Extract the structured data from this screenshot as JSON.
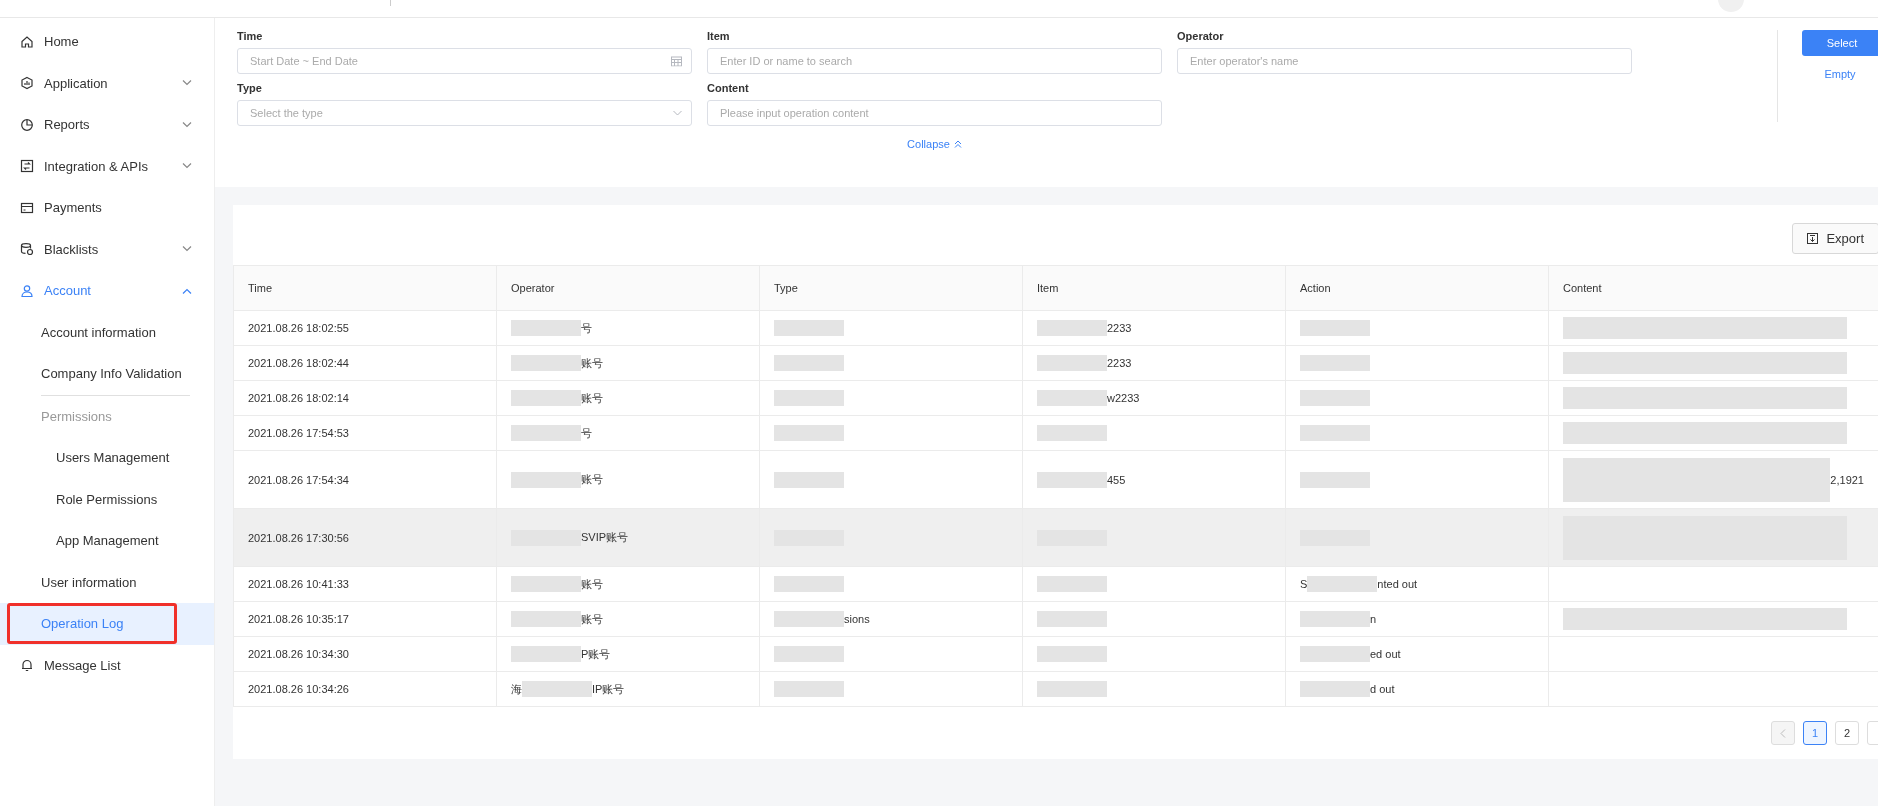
{
  "sidebar": {
    "items": [
      {
        "label": "Home",
        "kind": "link",
        "selected": false
      },
      {
        "label": "Application",
        "kind": "group",
        "expanded": false,
        "selected": false
      },
      {
        "label": "Reports",
        "kind": "group",
        "expanded": false,
        "selected": false
      },
      {
        "label": "Integration & APIs",
        "kind": "group",
        "expanded": false,
        "selected": false
      },
      {
        "label": "Payments",
        "kind": "link",
        "selected": false
      },
      {
        "label": "Blacklists",
        "kind": "group",
        "expanded": false,
        "selected": false
      },
      {
        "label": "Account",
        "kind": "group",
        "expanded": true,
        "selected": true,
        "children": [
          {
            "label": "Account information",
            "kind": "link",
            "selected": false
          },
          {
            "label": "Company Info Validation",
            "kind": "link",
            "selected": false
          },
          {
            "label": "Permissions",
            "kind": "section",
            "children": [
              {
                "label": "Users Management",
                "selected": false
              },
              {
                "label": "Role Permissions",
                "selected": false
              },
              {
                "label": "App Management",
                "selected": false
              }
            ]
          },
          {
            "label": "User information",
            "kind": "link",
            "selected": false
          },
          {
            "label": "Operation Log",
            "kind": "link",
            "selected": true,
            "outlined": true
          }
        ]
      },
      {
        "label": "Message List",
        "kind": "link",
        "selected": false
      }
    ]
  },
  "filters": {
    "fields": [
      {
        "label": "Time",
        "placeholder": "Start Date ~ End Date",
        "kind": "date"
      },
      {
        "label": "Item",
        "placeholder": "Enter ID or name to search",
        "kind": "text"
      },
      {
        "label": "Operator",
        "placeholder": "Enter operator's name",
        "kind": "text"
      },
      {
        "label": "Type",
        "placeholder": "Select the type",
        "kind": "select"
      },
      {
        "label": "Content",
        "placeholder": "Please input operation content",
        "kind": "text"
      }
    ],
    "collapse": "Collapse",
    "select_button": "Select",
    "empty_link": "Empty"
  },
  "export_button": "Export",
  "table": {
    "columns": [
      "Time",
      "Operator",
      "Type",
      "Item",
      "Action",
      "Content"
    ],
    "rows": [
      {
        "kind": "single",
        "selected": false,
        "cells": [
          {
            "text": "2021.08.26 18:02:55"
          },
          {
            "redacted": true,
            "text": "号"
          },
          {
            "redacted": true
          },
          {
            "redacted": true,
            "text": "2233"
          },
          {
            "redacted": true
          },
          {
            "redacted": true
          }
        ]
      },
      {
        "kind": "single",
        "selected": false,
        "cells": [
          {
            "text": "2021.08.26 18:02:44"
          },
          {
            "redacted": true,
            "text": "账号"
          },
          {
            "redacted": true
          },
          {
            "redacted": true,
            "text": "2233"
          },
          {
            "redacted": true
          },
          {
            "redacted": true
          }
        ]
      },
      {
        "kind": "single",
        "selected": false,
        "cells": [
          {
            "text": "2021.08.26 18:02:14"
          },
          {
            "redacted": true,
            "text": "账号"
          },
          {
            "redacted": true
          },
          {
            "redacted": true,
            "text": "w2233"
          },
          {
            "redacted": true
          },
          {
            "redacted": true
          }
        ]
      },
      {
        "kind": "single",
        "selected": false,
        "cells": [
          {
            "text": "2021.08.26 17:54:53"
          },
          {
            "redacted": true,
            "text": "号"
          },
          {
            "redacted": true
          },
          {
            "redacted": true
          },
          {
            "redacted": true
          },
          {
            "redacted": true
          }
        ]
      },
      {
        "kind": "double",
        "selected": false,
        "cells": [
          {
            "text": "2021.08.26 17:54:34"
          },
          {
            "redacted": true,
            "text": "账号"
          },
          {
            "redacted": true
          },
          {
            "redacted": true,
            "text": "455"
          },
          {
            "redacted": true
          },
          {
            "redacted": true,
            "text": "2,1921"
          }
        ]
      },
      {
        "kind": "double",
        "selected": true,
        "cells": [
          {
            "text": "2021.08.26 17:30:56"
          },
          {
            "redacted": true,
            "text": "SVIP账号"
          },
          {
            "redacted": true
          },
          {
            "redacted": true
          },
          {
            "redacted": true
          },
          {
            "redacted": true
          }
        ]
      },
      {
        "kind": "single",
        "selected": false,
        "cells": [
          {
            "text": "2021.08.26 10:41:33"
          },
          {
            "redacted": true,
            "text": "账号"
          },
          {
            "redacted": true
          },
          {
            "redacted": true
          },
          {
            "lead": "S",
            "redacted": true,
            "text": "nted out"
          },
          {}
        ]
      },
      {
        "kind": "single",
        "selected": false,
        "cells": [
          {
            "text": "2021.08.26 10:35:17"
          },
          {
            "redacted": true,
            "text": "账号"
          },
          {
            "redacted": true,
            "text": "sions"
          },
          {
            "redacted": true
          },
          {
            "redacted": true,
            "text": "n"
          },
          {
            "redacted": true
          }
        ]
      },
      {
        "kind": "single",
        "selected": false,
        "cells": [
          {
            "text": "2021.08.26 10:34:30"
          },
          {
            "redacted": true,
            "text": "P账号"
          },
          {
            "redacted": true
          },
          {
            "redacted": true
          },
          {
            "redacted": true,
            "text": "ed out"
          },
          {}
        ]
      },
      {
        "kind": "single",
        "selected": false,
        "cells": [
          {
            "text": "2021.08.26 10:34:26"
          },
          {
            "lead": "海",
            "redacted": true,
            "text": "IP账号"
          },
          {
            "redacted": true
          },
          {
            "redacted": true
          },
          {
            "redacted": true,
            "text": "d out"
          },
          {}
        ]
      }
    ]
  },
  "pagination": {
    "pages": [
      {
        "label": "1",
        "selected": true
      },
      {
        "label": "2",
        "selected": false
      }
    ]
  }
}
